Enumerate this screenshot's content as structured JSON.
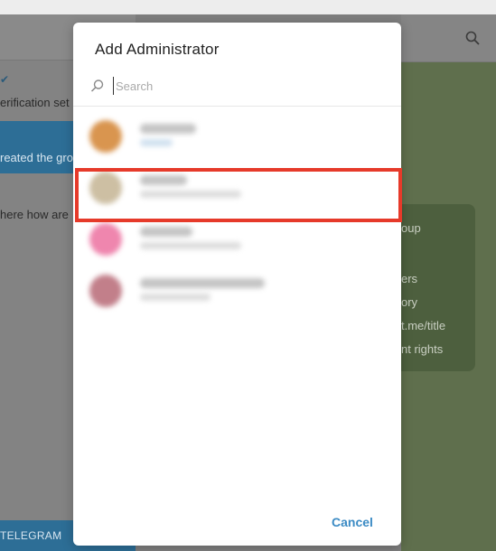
{
  "background": {
    "left_rows": [
      "erification set",
      "reated the gro",
      "here how are"
    ],
    "left_bottom_label": "TELEGRAM",
    "right_bubble_lines": [
      "oup",
      "ers",
      "ory",
      "t.me/title",
      "nt rights"
    ]
  },
  "dialog": {
    "title": "Add Administrator",
    "search_placeholder": "Search",
    "contacts": [
      {
        "avatar_color": "#d9954f"
      },
      {
        "avatar_color": "#cdbfa3"
      },
      {
        "avatar_color": "#ef86ae"
      },
      {
        "avatar_color": "#c27f8a"
      }
    ],
    "cancel_label": "Cancel"
  },
  "colors": {
    "accent": "#3b8bc4",
    "highlight": "#e63a2a",
    "selected_chat": "#2d6e96"
  },
  "icons": {
    "search": "search-icon",
    "verify": "verified-badge-icon"
  }
}
